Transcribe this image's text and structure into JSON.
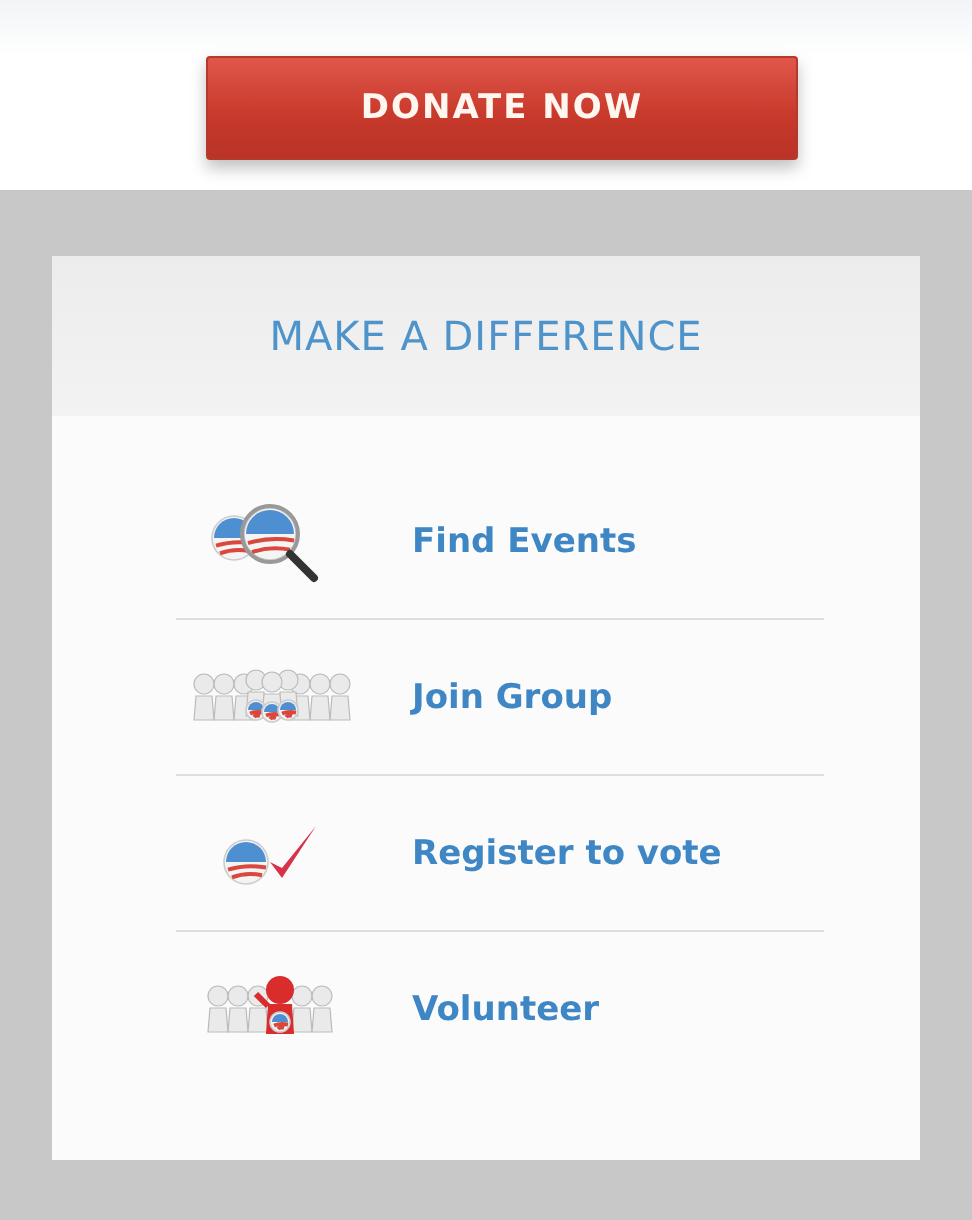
{
  "donate_button": {
    "label": "DONATE NOW"
  },
  "panel": {
    "title": "MAKE A DIFFERENCE",
    "items": [
      {
        "kind": "search",
        "label": "Find Events"
      },
      {
        "kind": "group",
        "label": "Join Group"
      },
      {
        "kind": "check",
        "label": "Register to vote"
      },
      {
        "kind": "volunteer",
        "label": "Volunteer"
      }
    ]
  }
}
